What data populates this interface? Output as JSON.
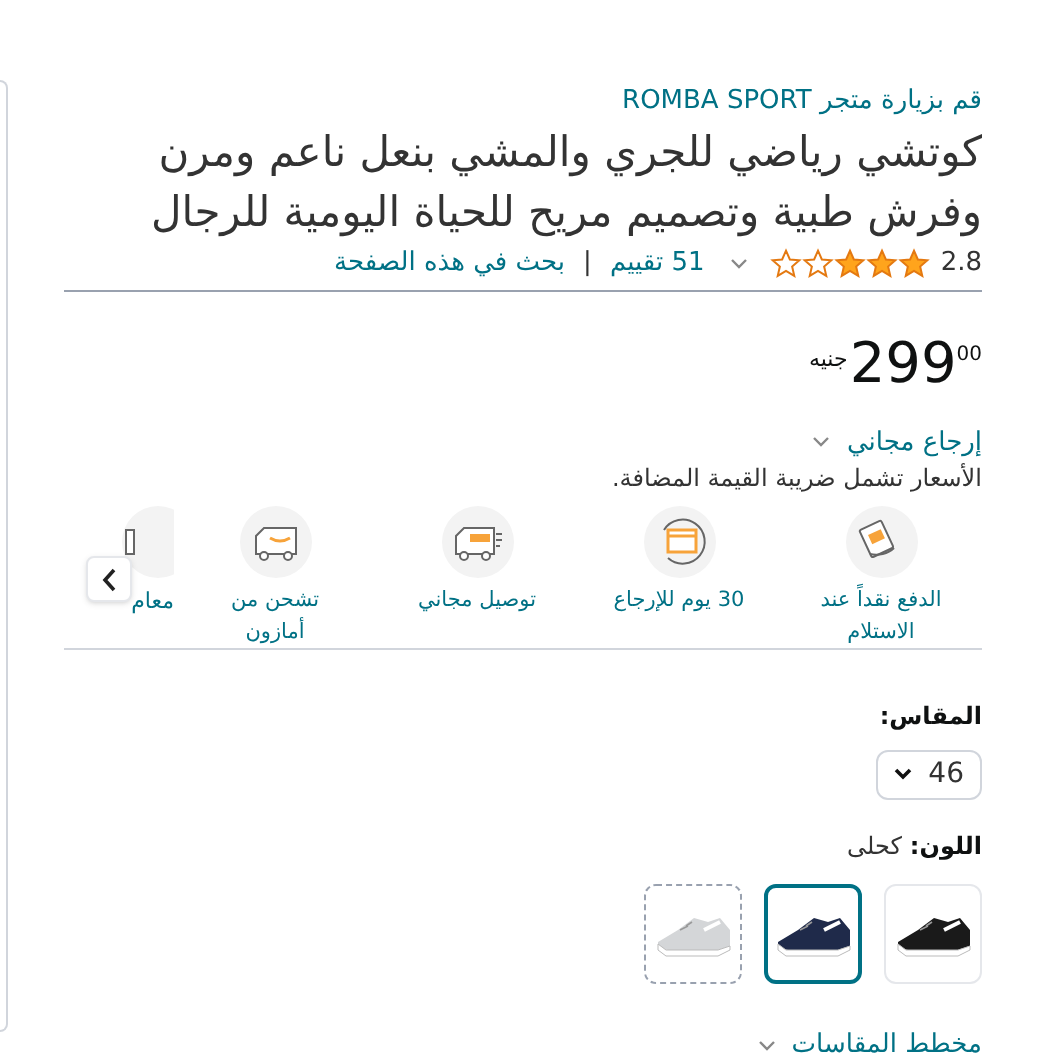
{
  "store_link": "قم بزيارة متجر ROMBA SPORT",
  "title": "كوتشي رياضي للجري والمشي بنعل ناعم ومرن وفرش طبية وتصميم مريح للحياة اليومية للرجال",
  "rating": {
    "value": "2.8",
    "stars": 3,
    "count": "51 تقييم",
    "separator": "|",
    "search_link": "بحث في هذه الصفحة"
  },
  "price": {
    "whole": "299",
    "fraction": "00",
    "currency": "جنيه"
  },
  "free_returns": "إرجاع مجاني",
  "vat_note": "الأسعار تشمل ضريبة القيمة المضافة.",
  "features": [
    {
      "kind": "cash",
      "label": "الدفع نقداً عند الاستلام"
    },
    {
      "kind": "return",
      "label": "30 يوم للإرجاع"
    },
    {
      "kind": "free_delivery",
      "label": "توصيل مجاني"
    },
    {
      "kind": "shipping",
      "label": "تشحن من أمازون"
    },
    {
      "kind": "partial",
      "label": "معام"
    }
  ],
  "size": {
    "label": "المقاس:",
    "value": "46"
  },
  "color": {
    "label": "اللون:",
    "value": "كحلى"
  },
  "swatches": [
    {
      "selected": false,
      "available": true
    },
    {
      "selected": true,
      "available": true
    },
    {
      "selected": false,
      "available": false
    }
  ],
  "size_chart": "مخطط المقاسات"
}
